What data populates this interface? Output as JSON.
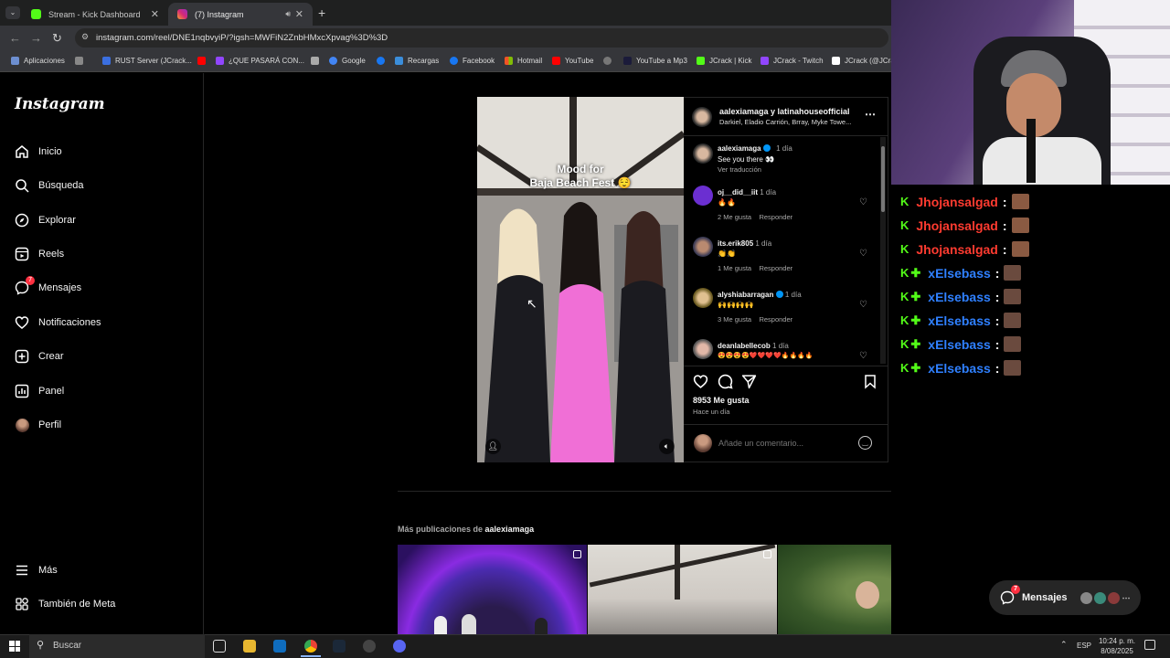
{
  "browser": {
    "tabs": [
      {
        "label": "Stream - Kick Dashboard",
        "active": false
      },
      {
        "label": "(7) Instagram",
        "active": true
      }
    ],
    "url": "instagram.com/reel/DNE1nqbvyiP/?igsh=MWFiN2ZnbHMxcXpvag%3D%3D",
    "bookmarks": [
      "Aplicaciones",
      "RUST Server (JCrack...",
      "¿QUE PASARÁ CON...",
      "Google",
      "Recargas",
      "Facebook",
      "Hotmail",
      "YouTube",
      "YouTube a Mp3",
      "JCrack | Kick",
      "JCrack - Twitch",
      "JCrack (@JCra"
    ]
  },
  "sidebar": {
    "logo": "Instagram",
    "items": [
      {
        "label": "Inicio",
        "icon": "home-icon"
      },
      {
        "label": "Búsqueda",
        "icon": "search-icon"
      },
      {
        "label": "Explorar",
        "icon": "compass-icon"
      },
      {
        "label": "Reels",
        "icon": "reels-icon"
      },
      {
        "label": "Mensajes",
        "icon": "messenger-icon",
        "badge": "7"
      },
      {
        "label": "Notificaciones",
        "icon": "heart-icon"
      },
      {
        "label": "Crear",
        "icon": "plus-square-icon"
      },
      {
        "label": "Panel",
        "icon": "chart-icon"
      },
      {
        "label": "Perfil",
        "icon": "avatar"
      }
    ],
    "bottom": [
      {
        "label": "Más",
        "icon": "menu-icon"
      },
      {
        "label": "También de Meta",
        "icon": "meta-icon"
      }
    ]
  },
  "reel": {
    "caption": "Mood for\nBaja Beach Fest 😌"
  },
  "post": {
    "header_title": "aalexiamaga y latinahouseofficial",
    "header_sub": "Darkiel, Eladio Carrión, Brray, Myke Towe...",
    "owner_comment": {
      "user": "aalexiamaga",
      "time": "1 día",
      "text": "See you there 👀",
      "translate": "Ver traducción"
    },
    "comments": [
      {
        "user": "oj__did__iit",
        "time": "1 día",
        "text": "🔥🔥",
        "likes": "2 Me gusta",
        "reply": "Responder"
      },
      {
        "user": "its.erik805",
        "time": "1 día",
        "text": "👏👏",
        "likes": "1 Me gusta",
        "reply": "Responder"
      },
      {
        "user": "alyshiabarragan",
        "time": "1 día",
        "text": "🙌🙌🙌🙌",
        "likes": "3 Me gusta",
        "reply": "Responder"
      },
      {
        "user": "deanlabellecob",
        "time": "1 día",
        "text": "😍😍😍😍❤️❤️❤️❤️🔥🔥🔥🔥"
      }
    ],
    "likes": "8953 Me gusta",
    "posted": "Hace un día",
    "comment_placeholder": "Añade un comentario..."
  },
  "more": {
    "prefix": "Más publicaciones de",
    "user": "aalexiamaga"
  },
  "chat": [
    {
      "user": "Jhojansalgad",
      "color": "#ff3b30",
      "badges": 1
    },
    {
      "user": "Jhojansalgad",
      "color": "#ff3b30",
      "badges": 1
    },
    {
      "user": "Jhojansalgad",
      "color": "#ff3b30",
      "badges": 1
    },
    {
      "user": "xElsebass",
      "color": "#2f80ff",
      "badges": 2
    },
    {
      "user": "xElsebass",
      "color": "#2f80ff",
      "badges": 2
    },
    {
      "user": "xElsebass",
      "color": "#2f80ff",
      "badges": 2
    },
    {
      "user": "xElsebass",
      "color": "#2f80ff",
      "badges": 2
    },
    {
      "user": "xElsebass",
      "color": "#2f80ff",
      "badges": 2
    }
  ],
  "messages_pill": {
    "label": "Mensajes",
    "badge": "7"
  },
  "taskbar": {
    "search": "Buscar",
    "lang": "ESP",
    "time": "10:24 p. m.",
    "date": "8/08/2025"
  }
}
